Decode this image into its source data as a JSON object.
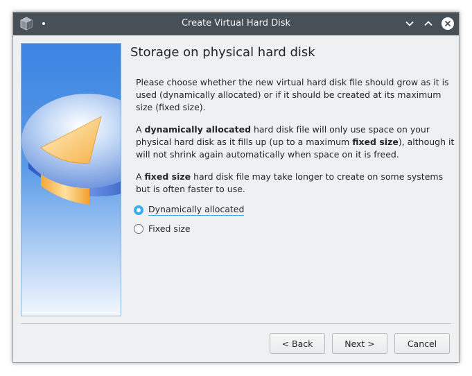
{
  "window": {
    "title": "Create Virtual Hard Disk"
  },
  "titlebar": {
    "app_icon": "virtualbox-cube-icon",
    "pin_icon": "pin-dot-icon",
    "minimize_icon": "chevron-down-icon",
    "maximize_icon": "chevron-up-icon",
    "close_icon": "close-icon"
  },
  "side_image": {
    "icon": "hard-disk-pie-illustration"
  },
  "page": {
    "title": "Storage on physical hard disk",
    "para1": "Please choose whether the new virtual hard disk file should grow as it is used (dynamically allocated) or if it should be created at its maximum size (fixed size).",
    "para2_pre": "A ",
    "para2_bold1": "dynamically allocated",
    "para2_mid": " hard disk file will only use space on your physical hard disk as it fills up (up to a maximum ",
    "para2_bold2": "fixed size",
    "para2_post": "), although it will not shrink again automatically when space on it is freed.",
    "para3_pre": "A ",
    "para3_bold": "fixed size",
    "para3_post": " hard disk file may take longer to create on some systems but is often faster to use."
  },
  "options": [
    {
      "label": "Dynamically allocated",
      "selected": true
    },
    {
      "label": "Fixed size",
      "selected": false
    }
  ],
  "buttons": {
    "back": "< Back",
    "next": "Next >",
    "cancel": "Cancel"
  },
  "colors": {
    "titlebar": "#475057",
    "window_bg": "#eff0f1",
    "accent": "#3daee9",
    "text": "#232629"
  }
}
